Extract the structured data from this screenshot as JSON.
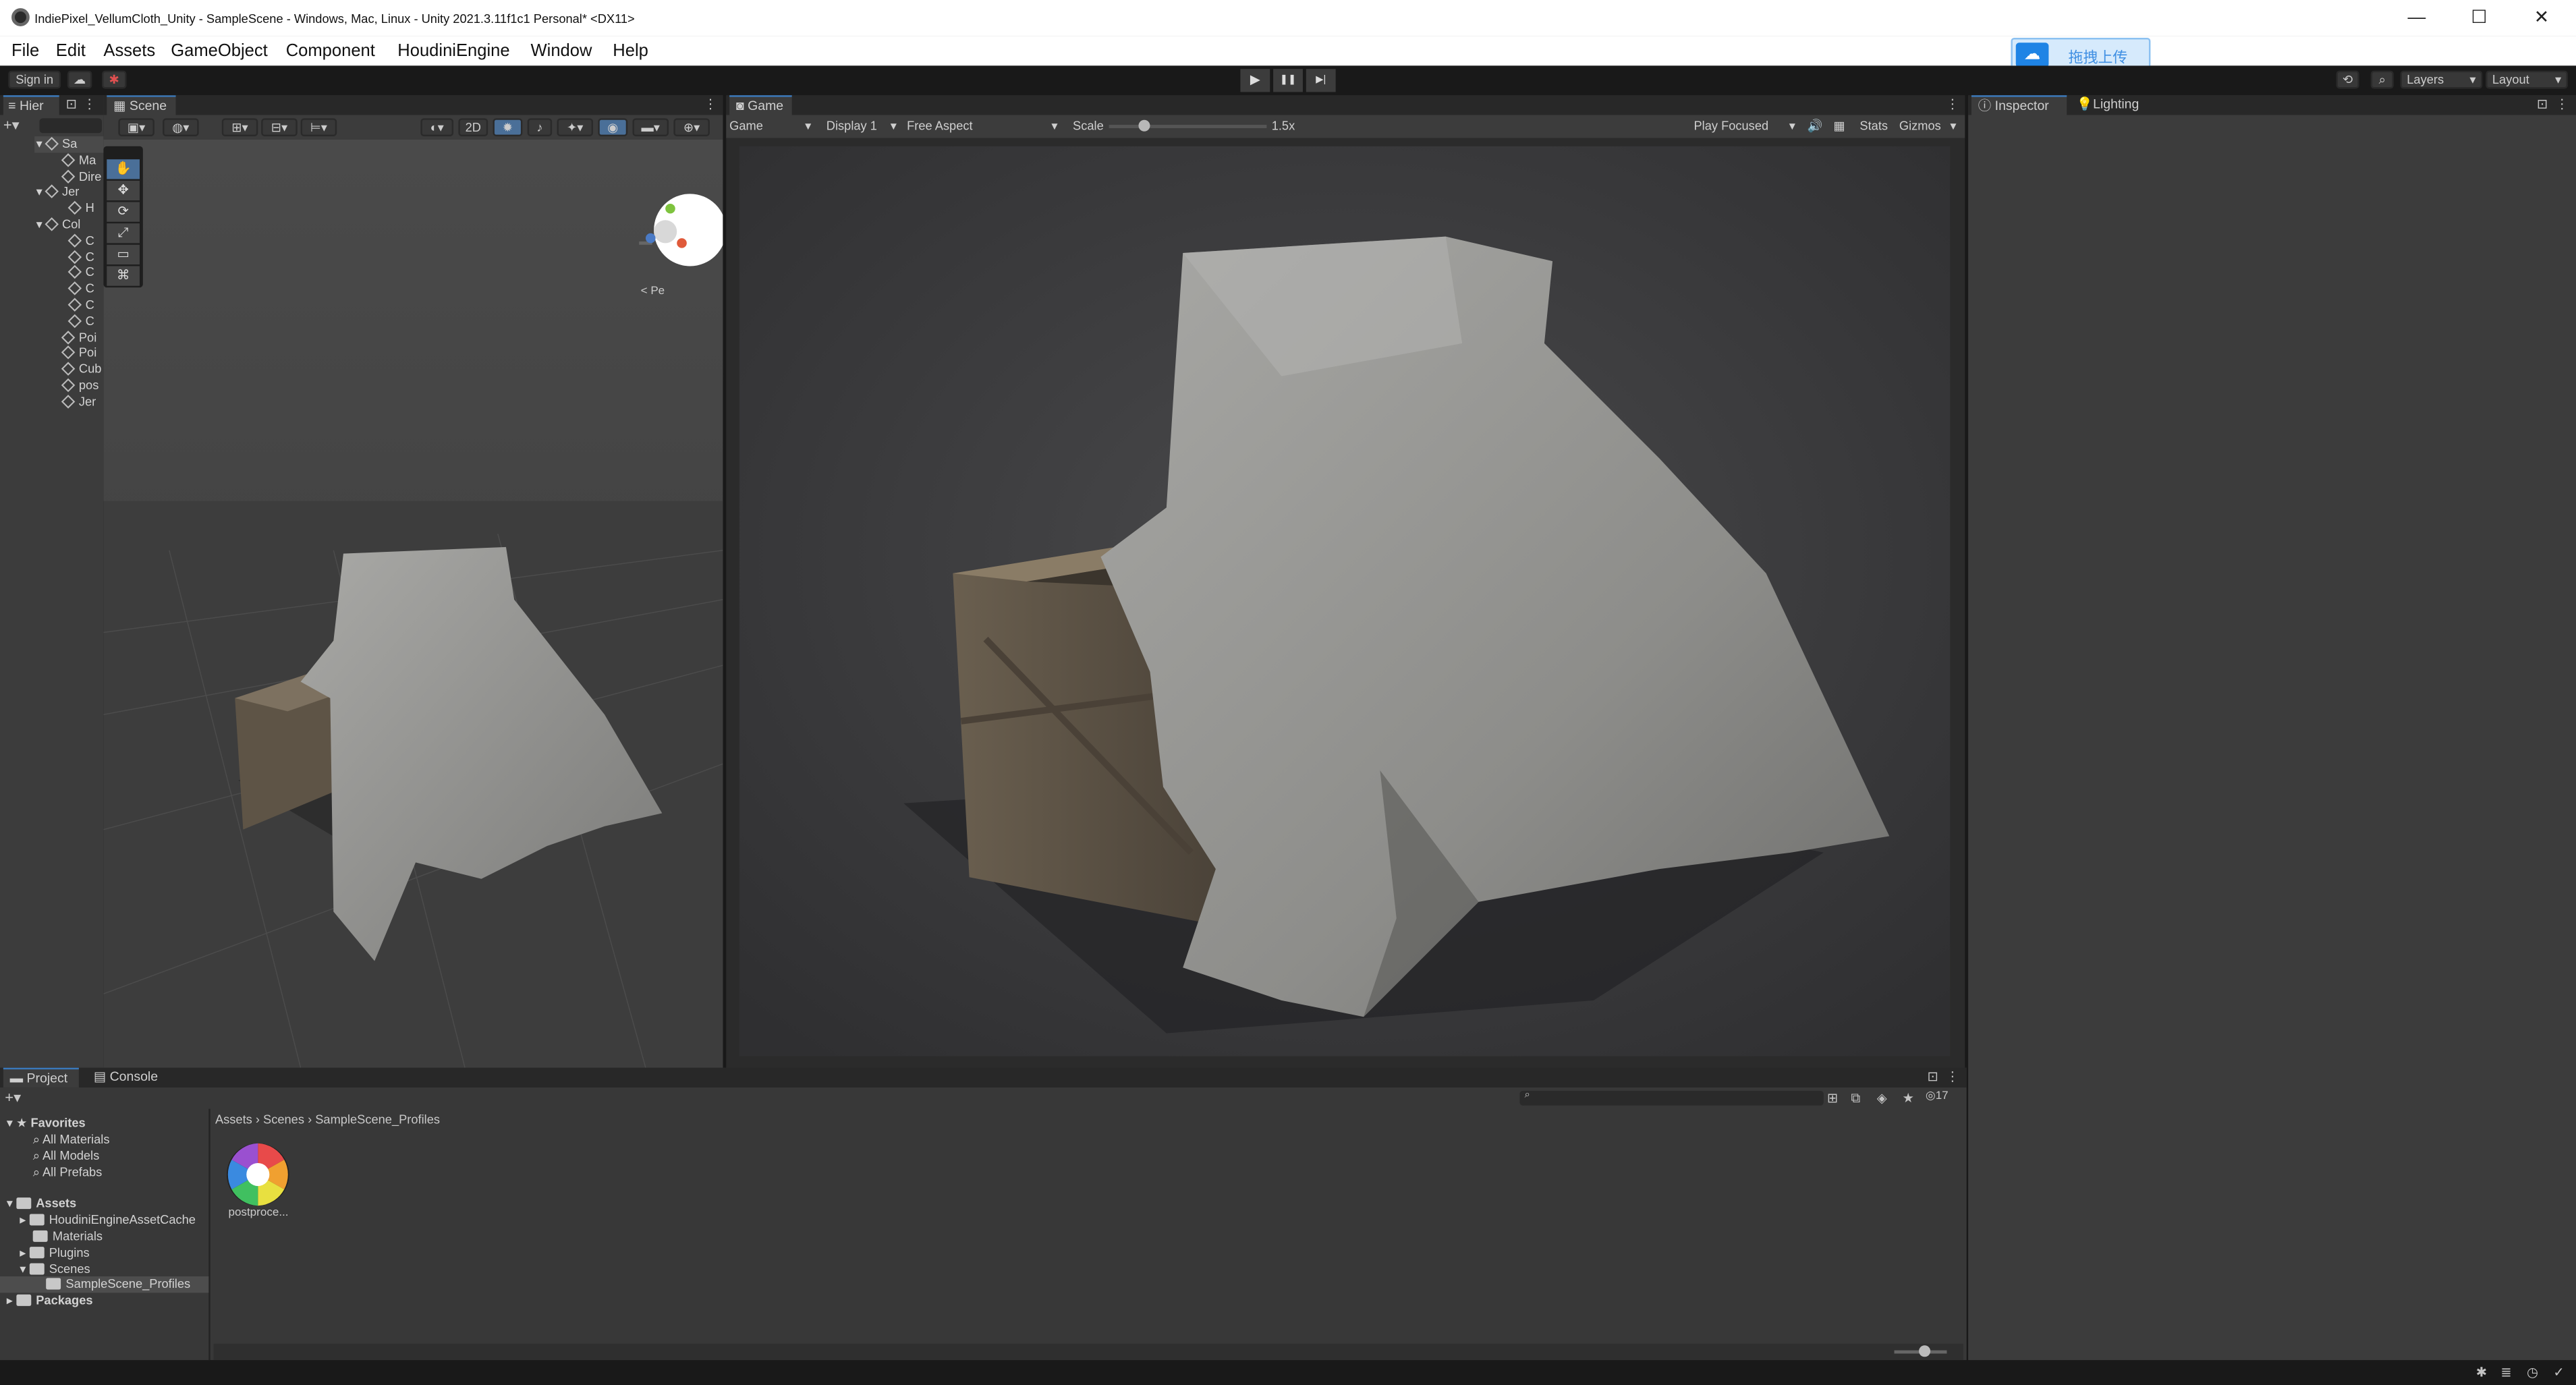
{
  "window": {
    "title": "IndiePixel_VellumCloth_Unity - SampleScene - Windows, Mac, Linux - Unity 2021.3.11f1c1 Personal* <DX11>",
    "controls": {
      "minimize": "—",
      "maximize": "☐",
      "close": "✕"
    }
  },
  "menu": [
    "File",
    "Edit",
    "Assets",
    "GameObject",
    "Component",
    "HoudiniEngine",
    "Window",
    "Help"
  ],
  "upload": {
    "label": "拖拽上传",
    "icon": "cloud-icon"
  },
  "toolbar": {
    "sign_in": "Sign in",
    "layers": "Layers",
    "layout": "Layout",
    "play_icons": [
      "▶",
      "❚❚",
      "▶|"
    ]
  },
  "hierarchy": {
    "tab": "Hier",
    "rows": [
      "Sa",
      "Ma",
      "Dire",
      "Jer",
      "H",
      "Col",
      "C",
      "C",
      "C",
      "C",
      "C",
      "C",
      "Poi",
      "Poi",
      "Cub",
      "pos",
      "Jer"
    ]
  },
  "scene": {
    "tab": "Scene",
    "toolbar": {
      "mode_2d": "2D"
    },
    "gizmo_label": "< Pe",
    "tools": [
      "✋",
      "✥",
      "⟳",
      "⤢",
      "▭",
      "⌘"
    ]
  },
  "game": {
    "tab": "Game",
    "display_mode": "Game",
    "display": "Display 1",
    "aspect": "Free Aspect",
    "scale_label": "Scale",
    "scale_value": "1.5x",
    "scale_fraction": 0.22,
    "play_focused": "Play Focused",
    "stats": "Stats",
    "gizmos": "Gizmos"
  },
  "inspector": {
    "tabs": [
      "Inspector",
      "Lighting"
    ]
  },
  "project": {
    "tabs": [
      "Project",
      "Console"
    ],
    "favorites": {
      "title": "Favorites",
      "items": [
        "All Materials",
        "All Models",
        "All Prefabs"
      ]
    },
    "assets": {
      "title": "Assets",
      "items": [
        "HoudiniEngineAssetCache",
        "Materials",
        "Plugins",
        "Scenes",
        "SampleScene_Profiles"
      ]
    },
    "packages": "Packages",
    "breadcrumb": [
      "Assets",
      "Scenes",
      "SampleScene_Profiles"
    ],
    "asset_item": "postproce...",
    "hidden_count": "17"
  },
  "colors": {
    "accent": "#3a79bb",
    "upload_blue": "#1f84e5"
  }
}
